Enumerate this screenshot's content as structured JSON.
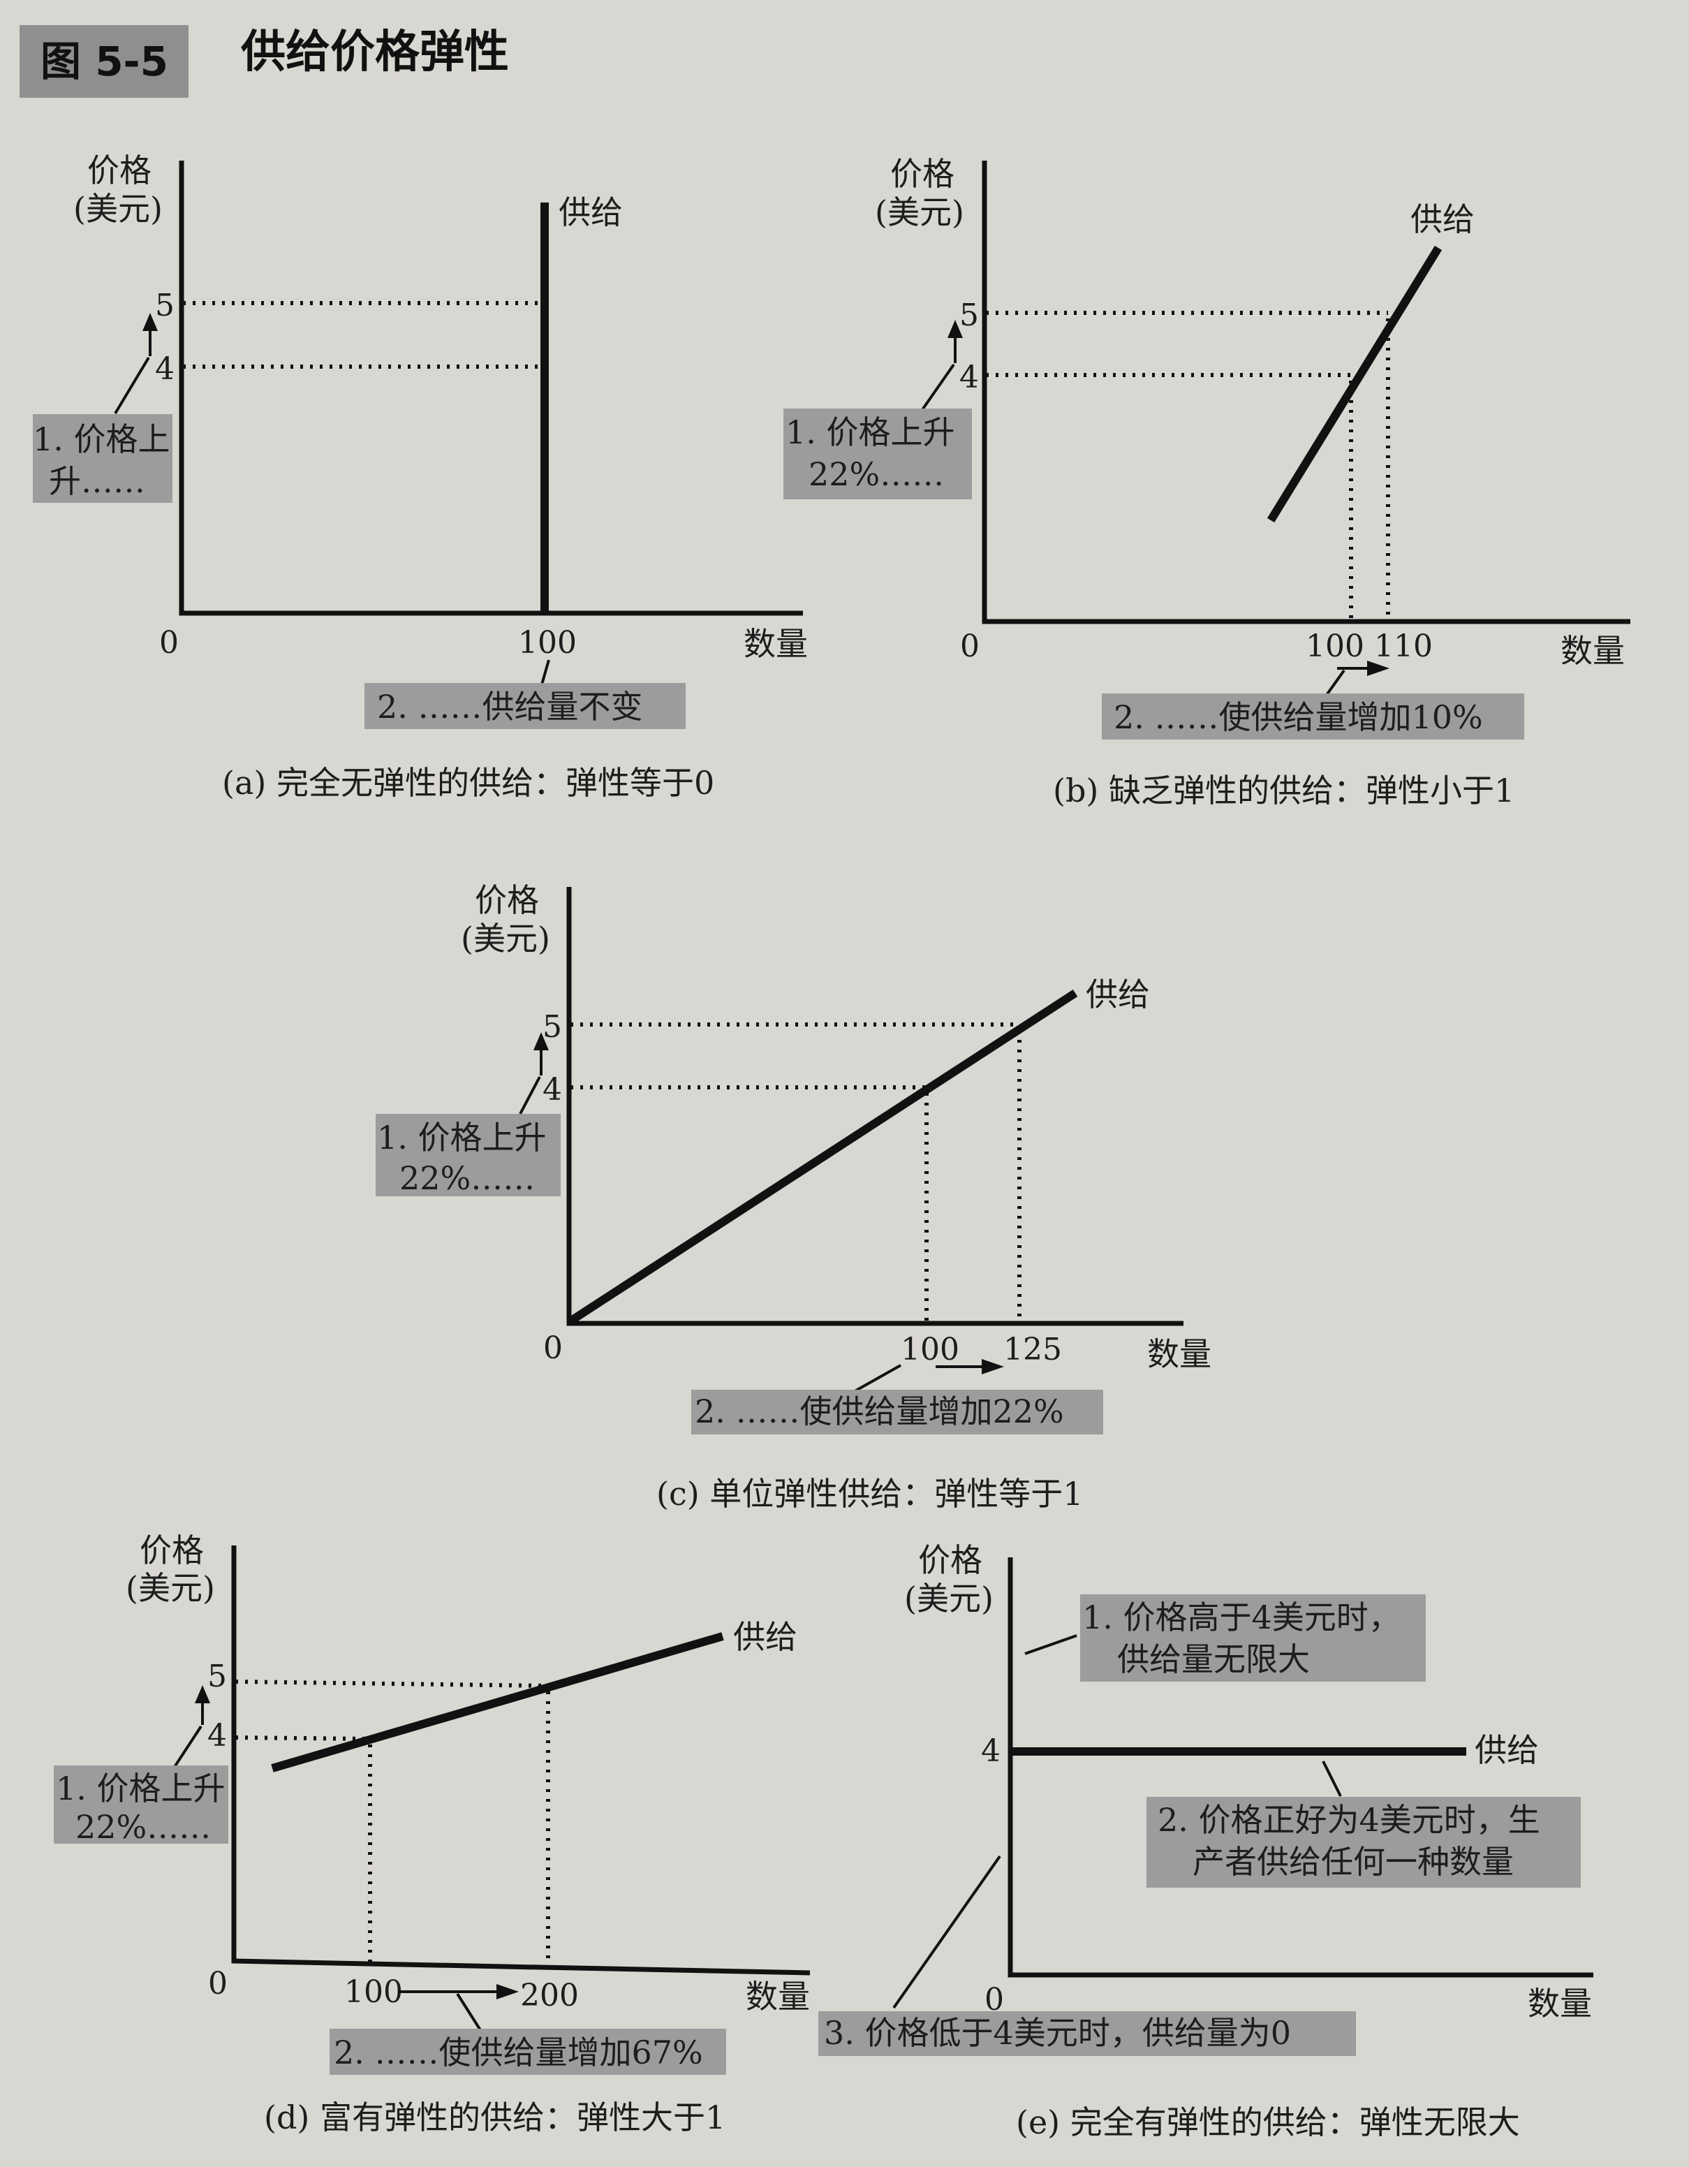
{
  "figure": {
    "tag": "图 5-5",
    "title": "供给价格弹性"
  },
  "chart_data": [
    {
      "id": "a",
      "type": "line",
      "caption": "(a) 完全无弹性的供给：弹性等于0",
      "xlabel": "数量",
      "ylabel": [
        "价格",
        "(美元)"
      ],
      "curve_label": "供给",
      "x_ticks": [
        "0",
        "100"
      ],
      "y_ticks": [
        "4",
        "5"
      ],
      "supply": [
        {
          "q": 100,
          "p": 0
        },
        {
          "q": 100,
          "p": 6.6
        }
      ],
      "price_change": {
        "from": 4,
        "to": 5
      },
      "annotations": [
        "1. 价格上升……",
        "2. ……供给量不变"
      ]
    },
    {
      "id": "b",
      "type": "line",
      "caption": "(b) 缺乏弹性的供给：弹性小于1",
      "xlabel": "数量",
      "ylabel": [
        "价格",
        "(美元)"
      ],
      "curve_label": "供给",
      "x_ticks": [
        "0",
        "100",
        "110"
      ],
      "y_ticks": [
        "4",
        "5"
      ],
      "supply": [
        {
          "q": 100,
          "p": 4
        },
        {
          "q": 110,
          "p": 5
        }
      ],
      "price_change": {
        "from": 4,
        "to": 5
      },
      "quantity_change": {
        "from": 100,
        "to": 110
      },
      "annotations": [
        "1. 价格上升22%……",
        "2. ……使供给量增加10%"
      ]
    },
    {
      "id": "c",
      "type": "line",
      "caption": "(c) 单位弹性供给：弹性等于1",
      "xlabel": "数量",
      "ylabel": [
        "价格",
        "(美元)"
      ],
      "curve_label": "供给",
      "x_ticks": [
        "0",
        "100",
        "125"
      ],
      "y_ticks": [
        "4",
        "5"
      ],
      "supply": [
        {
          "q": 0,
          "p": 0
        },
        {
          "q": 100,
          "p": 4
        },
        {
          "q": 125,
          "p": 5
        }
      ],
      "price_change": {
        "from": 4,
        "to": 5
      },
      "quantity_change": {
        "from": 100,
        "to": 125
      },
      "annotations": [
        "1. 价格上升22%……",
        "2. ……使供给量增加22%"
      ]
    },
    {
      "id": "d",
      "type": "line",
      "caption": "(d) 富有弹性的供给：弹性大于1",
      "xlabel": "数量",
      "ylabel": [
        "价格",
        "(美元)"
      ],
      "curve_label": "供给",
      "x_ticks": [
        "0",
        "100",
        "200"
      ],
      "y_ticks": [
        "4",
        "5"
      ],
      "supply": [
        {
          "q": 100,
          "p": 4
        },
        {
          "q": 200,
          "p": 5
        }
      ],
      "price_change": {
        "from": 4,
        "to": 5
      },
      "quantity_change": {
        "from": 100,
        "to": 200
      },
      "annotations": [
        "1. 价格上升22%……",
        "2. ……使供给量增加67%"
      ]
    },
    {
      "id": "e",
      "type": "line",
      "caption": "(e) 完全有弹性的供给：弹性无限大",
      "xlabel": "数量",
      "ylabel": [
        "价格",
        "(美元)"
      ],
      "curve_label": "供给",
      "x_ticks": [
        "0"
      ],
      "y_ticks": [
        "4"
      ],
      "supply": [
        {
          "q": 0,
          "p": 4
        },
        {
          "q": "∞",
          "p": 4
        }
      ],
      "annotations": [
        "1. 价格高于4美元时，供给量无限大",
        "2. 价格正好为4美元时，生产者供给任何一种数量",
        "3. 价格低于4美元时，供给量为0"
      ]
    }
  ],
  "text": {
    "a": {
      "y1": "价格",
      "y2": "(美元)",
      "x": "数量",
      "curve": "供给",
      "t0": "0",
      "t100": "100",
      "p4": "4",
      "p5": "5",
      "n1a": "1. 价格上",
      "n1b": "升……",
      "n2": "2. ……供给量不变",
      "caption": "(a) 完全无弹性的供给：弹性等于0"
    },
    "b": {
      "y1": "价格",
      "y2": "(美元)",
      "x": "数量",
      "curve": "供给",
      "t0": "0",
      "t100": "100",
      "t110": "110",
      "p4": "4",
      "p5": "5",
      "n1a": "1. 价格上升",
      "n1b": "22%……",
      "n2": "2. ……使供给量增加10%",
      "caption": "(b) 缺乏弹性的供给：弹性小于1"
    },
    "c": {
      "y1": "价格",
      "y2": "(美元)",
      "x": "数量",
      "curve": "供给",
      "t0": "0",
      "t100": "100",
      "t125": "125",
      "p4": "4",
      "p5": "5",
      "n1a": "1. 价格上升",
      "n1b": "22%……",
      "n2": "2. ……使供给量增加22%",
      "caption": "(c) 单位弹性供给：弹性等于1"
    },
    "d": {
      "y1": "价格",
      "y2": "(美元)",
      "x": "数量",
      "curve": "供给",
      "t0": "0",
      "t100": "100",
      "t200": "200",
      "p4": "4",
      "p5": "5",
      "n1a": "1. 价格上升",
      "n1b": "22%……",
      "n2": "2. ……使供给量增加67%",
      "caption": "(d) 富有弹性的供给：弹性大于1"
    },
    "e": {
      "y1": "价格",
      "y2": "(美元)",
      "x": "数量",
      "curve": "供给",
      "t0": "0",
      "p4": "4",
      "n1a": "1. 价格高于4美元时，",
      "n1b": "供给量无限大",
      "n2a": "2. 价格正好为4美元时，生",
      "n2b": "产者供给任何一种数量",
      "n3": "3. 价格低于4美元时，供给量为0",
      "caption": "(e) 完全有弹性的供给：弹性无限大"
    }
  }
}
